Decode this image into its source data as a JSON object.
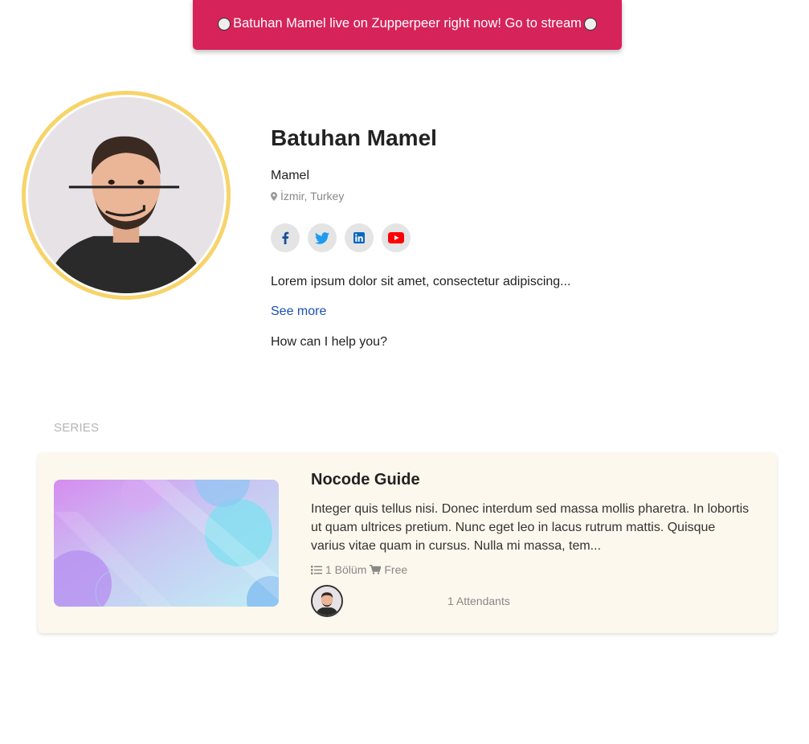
{
  "banner": {
    "text": "Batuhan Mamel live on Zupperpeer right now! Go to stream"
  },
  "profile": {
    "name": "Batuhan Mamel",
    "username": "Mamel",
    "location": "İzmir, Turkey",
    "socials": [
      {
        "name": "facebook",
        "icon": "facebook-icon",
        "color": "#1a4f9c"
      },
      {
        "name": "twitter",
        "icon": "twitter-icon",
        "color": "#1d9bf0"
      },
      {
        "name": "linkedin",
        "icon": "linkedin-icon",
        "color": "#0a66c2"
      },
      {
        "name": "youtube",
        "icon": "youtube-icon",
        "color": "#ff0000"
      }
    ],
    "bio": "Lorem ipsum dolor sit amet, consectetur adipiscing...",
    "see_more": "See more",
    "help": "How can I help you?"
  },
  "series": {
    "section_title": "SERIES",
    "items": [
      {
        "title": "Nocode Guide",
        "description": "Integer quis tellus nisi. Donec interdum sed massa mollis pharetra. In lobortis ut quam ultrices pretium. Nunc eget leo in lacus rutrum mattis. Quisque varius vitae quam in cursus. Nulla mi massa, tem...",
        "episodes": "1 Bölüm",
        "price": "Free",
        "attendants": "1 Attendants"
      }
    ]
  },
  "colors": {
    "banner": "#d6235a",
    "avatar_ring": "#f7d46a",
    "link": "#1b4fb0",
    "card_bg": "#fcf8ed"
  }
}
